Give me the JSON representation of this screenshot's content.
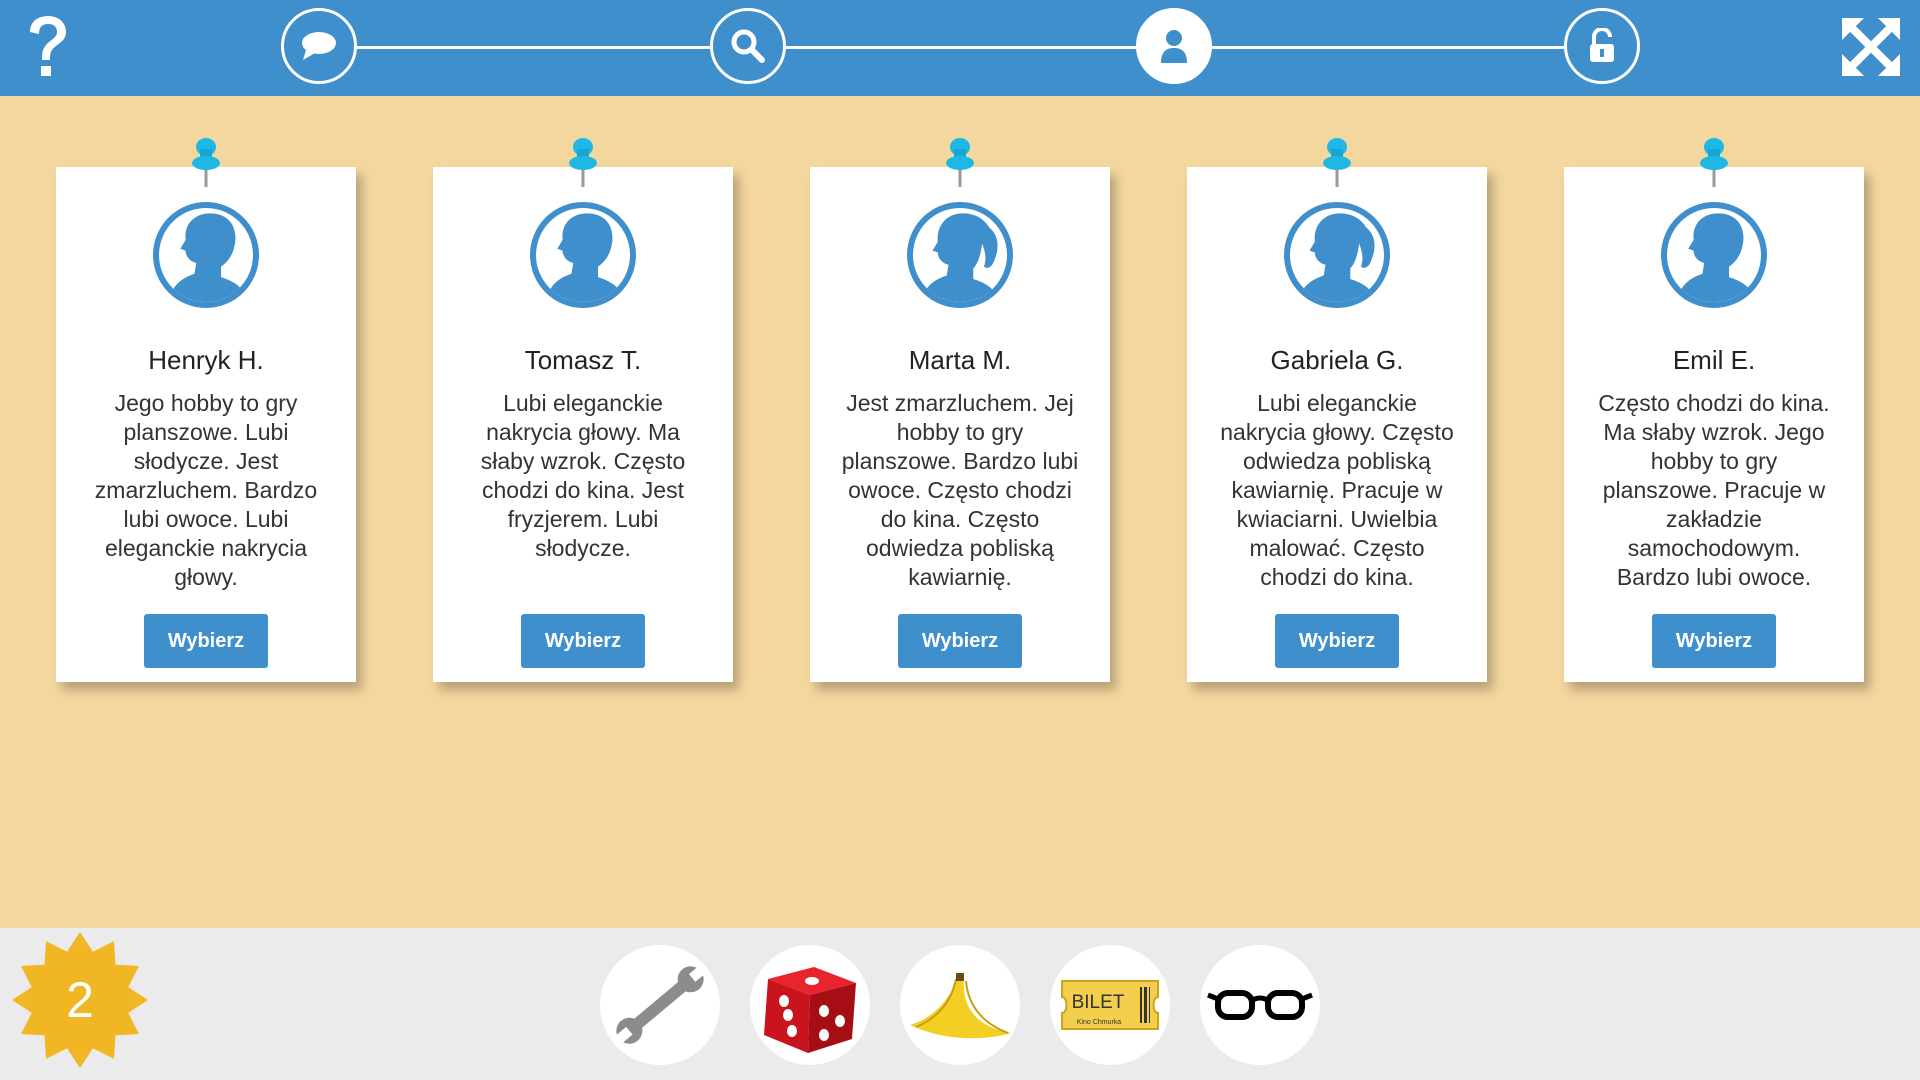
{
  "toolbar": {
    "help_icon": "question-mark-icon",
    "fullscreen_icon": "expand-arrows-icon",
    "steps": [
      {
        "icon": "speech-bubble-icon",
        "active": false
      },
      {
        "icon": "magnifier-icon",
        "active": false
      },
      {
        "icon": "person-icon",
        "active": true
      },
      {
        "icon": "unlocked-padlock-icon",
        "active": false
      }
    ]
  },
  "cards": [
    {
      "name": "Henryk H.",
      "gender": "male",
      "description": "Jego hobby to gry planszowe. Lubi słodycze. Jest zmarzluchem. Bardzo lubi owoce. Lubi eleganckie nakrycia głowy.",
      "button": "Wybierz"
    },
    {
      "name": "Tomasz T.",
      "gender": "male",
      "description": "Lubi eleganckie nakrycia głowy. Ma słaby wzrok. Często chodzi do kina. Jest fryzjerem. Lubi słodycze.",
      "button": "Wybierz"
    },
    {
      "name": "Marta M.",
      "gender": "female",
      "description": "Jest zmarzluchem. Jej hobby to gry planszowe. Bardzo lubi owoce. Często chodzi do kina. Często odwiedza pobliską kawiarnię.",
      "button": "Wybierz"
    },
    {
      "name": "Gabriela G.",
      "gender": "female",
      "description": "Lubi eleganckie nakrycia głowy. Często odwiedza pobliską kawiarnię. Pracuje w kwiaciarni. Uwielbia malować. Często chodzi do kina.",
      "button": "Wybierz"
    },
    {
      "name": "Emil E.",
      "gender": "male",
      "description": "Często chodzi do kina. Ma słaby wzrok. Jego hobby to gry planszowe. Pracuje w zakładzie samochodowym. Bardzo lubi owoce.",
      "button": "Wybierz"
    }
  ],
  "score": {
    "value": "2",
    "icon": "star-badge-icon"
  },
  "inventory": [
    {
      "icon": "wrench-icon"
    },
    {
      "icon": "dice-icon"
    },
    {
      "icon": "banana-icon"
    },
    {
      "icon": "ticket-icon",
      "label": "BILET",
      "sublabel": "Kino Chmurka"
    },
    {
      "icon": "glasses-icon"
    }
  ],
  "colors": {
    "accent": "#3f8fcd",
    "background": "#f4d79e",
    "bottom_bar": "#ebebeb",
    "star": "#f1b624",
    "pin": "#1fb8e6"
  }
}
